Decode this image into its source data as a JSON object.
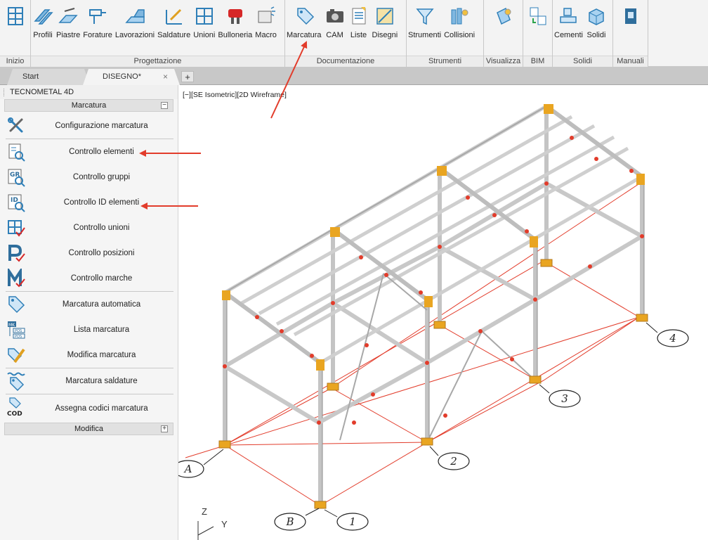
{
  "ribbon": {
    "inizio": {
      "label": "Inizio"
    },
    "progettazione": {
      "label": "Progettazione",
      "buttons": [
        "Profili",
        "Piastre",
        "Forature",
        "Lavorazioni",
        "Saldature",
        "Unioni",
        "Bulloneria",
        "Macro"
      ]
    },
    "documentazione": {
      "label": "Documentazione",
      "buttons": [
        "Marcatura",
        "CAM",
        "Liste",
        "Disegni"
      ]
    },
    "strumenti": {
      "label": "Strumenti",
      "buttons": [
        "Strumenti",
        "Collisioni"
      ]
    },
    "visualizza": {
      "label": "Visualizza"
    },
    "bim": {
      "label": "BIM"
    },
    "solidi": {
      "label": "Solidi",
      "buttons": [
        "Cementi",
        "Solidi"
      ]
    },
    "manuali": {
      "label": "Manuali"
    }
  },
  "tabs": {
    "start": "Start",
    "active": "DISEGNO*",
    "close": "×",
    "add": "+"
  },
  "panel": {
    "title": "TECNOMETAL 4D",
    "section_marcatura": "Marcatura",
    "section_marcatura_toggle": "−",
    "items": [
      {
        "label": "Configurazione marcatura",
        "icon": "tools-icon"
      },
      {
        "label": "Controllo elementi",
        "icon": "check-elements-icon"
      },
      {
        "label": "Controllo gruppi",
        "icon": "check-groups-icon"
      },
      {
        "label": "Controllo ID elementi",
        "icon": "check-id-icon"
      },
      {
        "label": "Controllo unioni",
        "icon": "check-joints-icon"
      },
      {
        "label": "Controllo posizioni",
        "icon": "check-positions-icon"
      },
      {
        "label": "Controllo marche",
        "icon": "check-marks-icon"
      },
      {
        "label": "Marcatura automatica",
        "icon": "tag-icon"
      },
      {
        "label": "Lista marcatura",
        "icon": "mark-list-icon"
      },
      {
        "label": "Modifica marcatura",
        "icon": "edit-tag-icon"
      },
      {
        "label": "Marcatura saldature",
        "icon": "weld-tag-icon"
      },
      {
        "label": "Assegna codici marcatura",
        "icon": "code-tag-icon"
      }
    ],
    "section_modifica": "Modifica",
    "section_modifica_toggle": "+"
  },
  "viewport": {
    "label": "[−][SE Isometric][2D Wireframe]",
    "axis_z": "Z",
    "axis_y": "Y",
    "grid_bubbles": [
      "A",
      "B",
      "1",
      "2",
      "3",
      "4"
    ]
  },
  "icon_glyphs": {
    "gr": "GR",
    "id": "ID",
    "mk": "MK",
    "pos": "POS",
    "cod": "COD"
  },
  "colors": {
    "accent": "#e23c2b",
    "steel": "#c9c9c9",
    "ribbon": "#f3f3f3",
    "icon_blue": "#2f7fb8"
  }
}
